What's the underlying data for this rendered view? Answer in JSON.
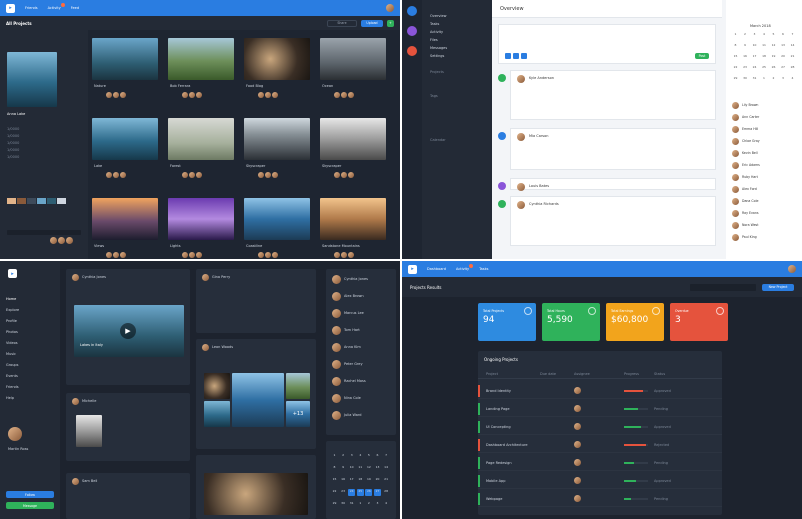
{
  "q1": {
    "nav": [
      "Friends",
      "Activity",
      "Feed"
    ],
    "toolbar": [
      "Share",
      "Upload"
    ],
    "title": "All Projects",
    "profile_name": "Anna Lake",
    "stats": [
      "1/0000",
      "1/0000",
      "1/0000",
      "1/0000",
      "1/0000"
    ],
    "tiles": [
      {
        "label": "Nature",
        "cls": "g1"
      },
      {
        "label": "Bob Ferrara",
        "cls": "g2"
      },
      {
        "label": "Food Blog",
        "cls": "g3"
      },
      {
        "label": "Ocean",
        "cls": "g4"
      },
      {
        "label": "Lake",
        "cls": "g5"
      },
      {
        "label": "Forest",
        "cls": "g6"
      },
      {
        "label": "Skyscraper",
        "cls": "g8"
      },
      {
        "label": "Skyscraper",
        "cls": "g7"
      },
      {
        "label": "Views",
        "cls": "g9"
      },
      {
        "label": "Lights",
        "cls": "g10"
      },
      {
        "label": "Coastline",
        "cls": "g11"
      },
      {
        "label": "Sandstone Mountains",
        "cls": "g12"
      }
    ]
  },
  "q2": {
    "title": "Overview",
    "menu": [
      "Overview",
      "Tasks",
      "Activity",
      "Files",
      "Messages",
      "Settings"
    ],
    "sidebar_groups": [
      "Projects",
      "Tags",
      "Calendar"
    ],
    "post_button": "Post",
    "feed_names": [
      "Kyle Anderson",
      "Mia Carson",
      "Louis Bates",
      "Cynthia Richards"
    ],
    "calendar_month": "March 2018",
    "contacts": [
      "Lily Brown",
      "Ann Carter",
      "Emma Hill",
      "Chloe Gray",
      "Kevin Bell",
      "Eric Adams",
      "Ruby Hart",
      "Alex Ford",
      "Dana Cole",
      "Ray Evans",
      "Nora West",
      "Paul King"
    ]
  },
  "q3": {
    "menu": [
      "Home",
      "Explore",
      "Profile",
      "Photos",
      "Videos",
      "Music",
      "Groups",
      "Events",
      "Friends",
      "Help"
    ],
    "user": "Martin Ross",
    "buttons": [
      "Follow",
      "Message"
    ],
    "video_label": "Lakes in Italy",
    "posts": [
      "Cynthia Jones",
      "Gina Perry",
      "Michelle",
      "Leon Woods",
      "Sam Bell"
    ],
    "people": [
      "Cynthia Jones",
      "Alex Brown",
      "Marcus Lee",
      "Tom Hart",
      "Anna Kim",
      "Peter Grey",
      "Rachel Moss",
      "Nina Cole",
      "Julia Ward"
    ],
    "plus_count": "+13"
  },
  "q4": {
    "nav": [
      "Dashboard",
      "Activity",
      "Tasks"
    ],
    "title": "Projects Results",
    "new_button": "New Project",
    "stats": [
      {
        "label": "Total Projects",
        "value": "94",
        "color": "#2e8be0"
      },
      {
        "label": "Total Hours",
        "value": "5,590",
        "color": "#2fb25b"
      },
      {
        "label": "Total Earnings",
        "value": "$60,800",
        "color": "#f2a41c"
      },
      {
        "label": "Overdue",
        "value": "3",
        "color": "#e5533d"
      }
    ],
    "table_title": "Ongoing Projects",
    "columns": [
      "Project",
      "Due date",
      "Assignee",
      "Progress",
      "Status"
    ],
    "rows": [
      {
        "name": "Brand Identity",
        "progress": 0.8,
        "status": "Approved",
        "bar": "#e5533d"
      },
      {
        "name": "Landing Page",
        "progress": 0.6,
        "status": "Pending",
        "bar": "#2fb25b"
      },
      {
        "name": "UI Concepting",
        "progress": 0.7,
        "status": "Approved",
        "bar": "#2fb25b"
      },
      {
        "name": "Dashboard Architecture",
        "progress": 0.9,
        "status": "Rejected",
        "bar": "#e5533d"
      },
      {
        "name": "Page Redesign",
        "progress": 0.4,
        "status": "Pending",
        "bar": "#2fb25b"
      },
      {
        "name": "Mobile App",
        "progress": 0.5,
        "status": "Approved",
        "bar": "#2fb25b"
      },
      {
        "name": "Webpage",
        "progress": 0.3,
        "status": "Pending",
        "bar": "#2fb25b"
      }
    ]
  }
}
